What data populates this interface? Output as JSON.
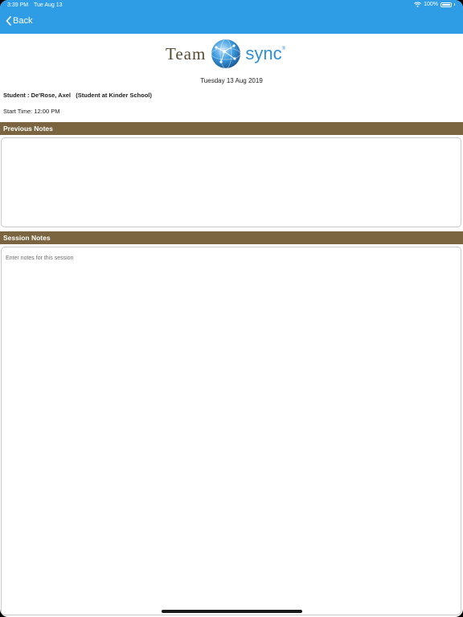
{
  "status_bar": {
    "time": "3:39 PM",
    "date": "Tue Aug 13",
    "battery": "100%"
  },
  "nav": {
    "back_label": "Back"
  },
  "logo": {
    "left_word": "Team",
    "right_word": "sync",
    "reg_mark": "®"
  },
  "session": {
    "date": "Tuesday 13 Aug 2019",
    "student_line": "Student : De'Rose, Axel   (Student at Kinder School)",
    "start_time": "Start Time: 12:00 PM"
  },
  "previous_notes": {
    "header": "Previous Notes",
    "value": ""
  },
  "session_notes": {
    "header": "Session Notes",
    "placeholder": "Enter notes for this session",
    "value": ""
  },
  "colors": {
    "nav_bar": "#2f9ce6",
    "section_header": "#7b6540",
    "logo_brown": "#5a4a33",
    "logo_blue": "#2f8fd3"
  }
}
